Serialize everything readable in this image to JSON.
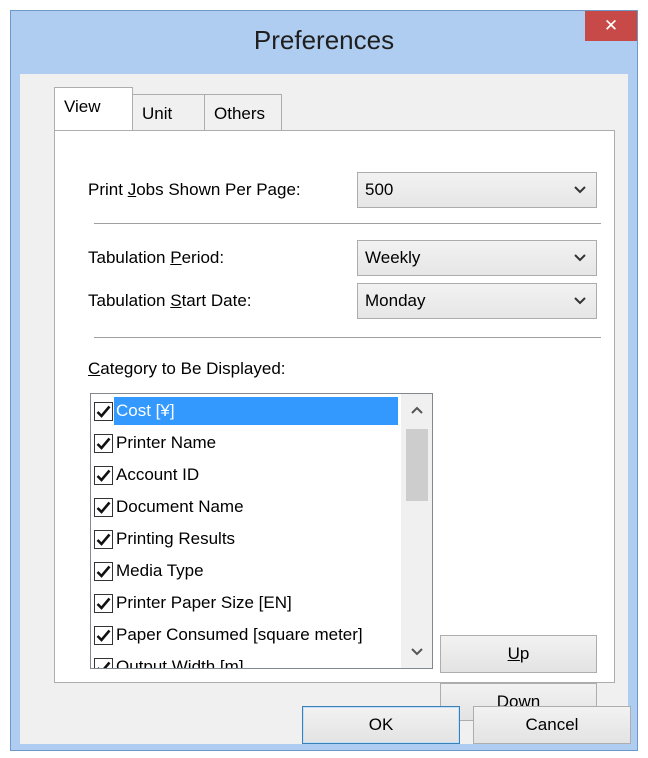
{
  "window": {
    "title": "Preferences",
    "close_symbol": "✕"
  },
  "tabs": [
    {
      "label": "View",
      "active": true
    },
    {
      "label": "Unit",
      "active": false
    },
    {
      "label": "Others",
      "active": false
    }
  ],
  "view": {
    "print_jobs": {
      "pre": "Print ",
      "mnemonic": "J",
      "post": "obs Shown Per Page:",
      "value": "500"
    },
    "tab_period": {
      "pre": "Tabulation ",
      "mnemonic": "P",
      "post": "eriod:",
      "value": "Weekly"
    },
    "tab_start": {
      "pre": "Tabulation ",
      "mnemonic": "S",
      "post": "tart Date:",
      "value": "Monday"
    },
    "category": {
      "pre": "",
      "mnemonic": "C",
      "post": "ategory to Be Displayed:"
    },
    "items": [
      {
        "label": "Cost [¥]",
        "checked": true,
        "selected": true
      },
      {
        "label": "Printer Name",
        "checked": true,
        "selected": false
      },
      {
        "label": "Account ID",
        "checked": true,
        "selected": false
      },
      {
        "label": "Document Name",
        "checked": true,
        "selected": false
      },
      {
        "label": "Printing Results",
        "checked": true,
        "selected": false
      },
      {
        "label": "Media Type",
        "checked": true,
        "selected": false
      },
      {
        "label": "Printer Paper Size [EN]",
        "checked": true,
        "selected": false
      },
      {
        "label": "Paper Consumed [square meter]",
        "checked": true,
        "selected": false
      },
      {
        "label": "Output Width [m]",
        "checked": true,
        "selected": false
      }
    ],
    "up": {
      "mnemonic": "U",
      "post": "p"
    },
    "down": {
      "mnemonic": "D",
      "post": "own"
    }
  },
  "footer": {
    "ok_label": "OK",
    "cancel_label": "Cancel"
  }
}
